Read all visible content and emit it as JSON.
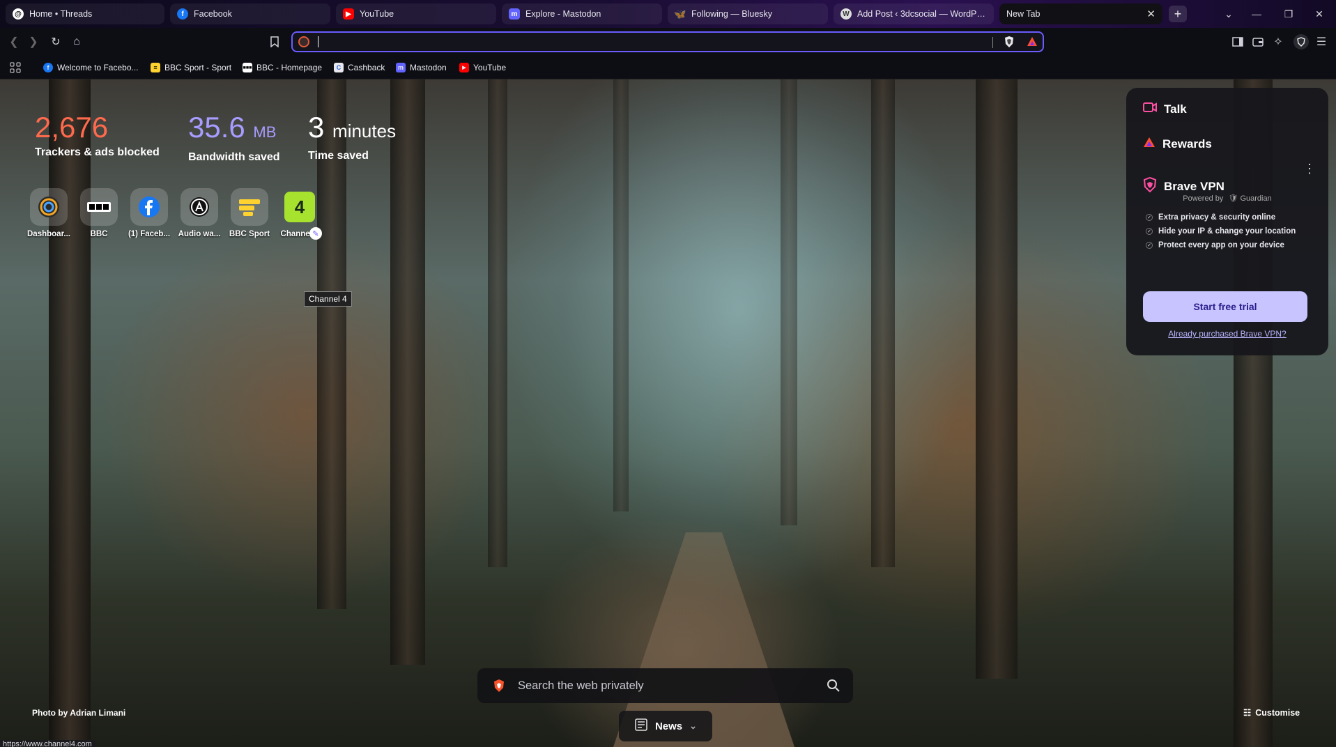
{
  "tabs": [
    {
      "label": "Home • Threads",
      "icon": "threads-icon"
    },
    {
      "label": "Facebook",
      "icon": "facebook-icon"
    },
    {
      "label": "YouTube",
      "icon": "youtube-icon"
    },
    {
      "label": "Explore - Mastodon",
      "icon": "mastodon-icon"
    },
    {
      "label": "Following — Bluesky",
      "icon": "bluesky-icon"
    },
    {
      "label": "Add Post ‹ 3dcsocial — WordPress",
      "icon": "wordpress-icon"
    },
    {
      "label": "New Tab",
      "icon": "none",
      "active": true
    }
  ],
  "toolbar": {
    "url_value": ""
  },
  "bookmarks": [
    {
      "label": "Welcome to Facebo...",
      "icon": "facebook-icon"
    },
    {
      "label": "BBC Sport - Sport",
      "icon": "bbc-sport-icon"
    },
    {
      "label": "BBC - Homepage",
      "icon": "bbc-icon"
    },
    {
      "label": "Cashback",
      "icon": "cashback-icon"
    },
    {
      "label": "Mastodon",
      "icon": "mastodon-icon"
    },
    {
      "label": "YouTube",
      "icon": "youtube-icon"
    }
  ],
  "stats": [
    {
      "value": "2,676",
      "unit": "",
      "label": "Trackers & ads blocked",
      "color": "#ff6a4d"
    },
    {
      "value": "35.6",
      "unit": "MB",
      "label": "Bandwidth saved",
      "color": "#a79cff"
    },
    {
      "value": "3",
      "unit": "minutes",
      "label": "Time saved",
      "color": "#ffffff"
    }
  ],
  "top_sites": [
    {
      "label": "Dashboar...",
      "icon": "dashboard-icon"
    },
    {
      "label": "BBC",
      "icon": "bbc-icon"
    },
    {
      "label": "(1) Faceb...",
      "icon": "facebook-icon"
    },
    {
      "label": "Audio wa...",
      "icon": "audio-icon"
    },
    {
      "label": "BBC Sport",
      "icon": "bbc-sport-icon"
    },
    {
      "label": "Channel 4",
      "icon": "channel4-icon"
    }
  ],
  "tooltip": "Channel 4",
  "panel": {
    "talk": "Talk",
    "rewards": "Rewards",
    "vpn": "Brave VPN",
    "powered_by": "Powered by",
    "powered_brand": "Guardian",
    "features": [
      "Extra privacy & security online",
      "Hide your IP & change your location",
      "Protect every app on your device"
    ],
    "trial_button": "Start free trial",
    "already": "Already purchased Brave VPN?"
  },
  "search": {
    "placeholder": "Search the web privately"
  },
  "photo_credit": "Photo by Adrian Limani",
  "news_label": "News",
  "customise_label": "Customise",
  "status_url": "https://www.channel4.com"
}
